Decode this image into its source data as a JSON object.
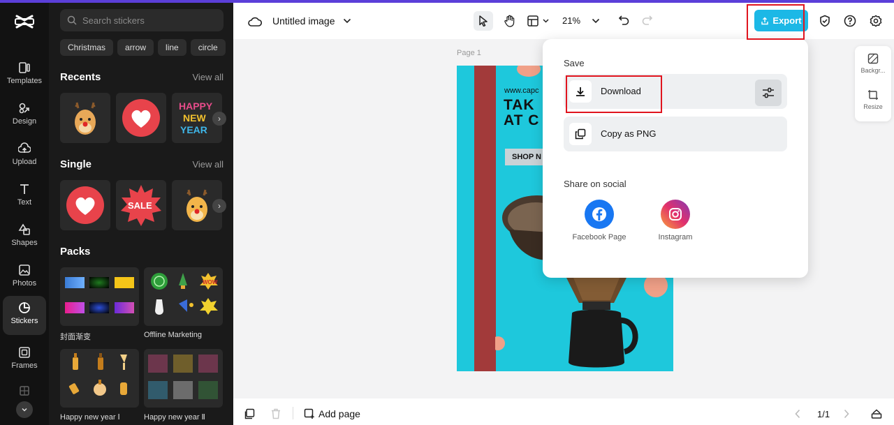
{
  "sidebar": {
    "items": [
      {
        "label": "Templates",
        "icon": "templates-icon"
      },
      {
        "label": "Design",
        "icon": "design-icon"
      },
      {
        "label": "Upload",
        "icon": "upload-icon"
      },
      {
        "label": "Text",
        "icon": "text-icon"
      },
      {
        "label": "Shapes",
        "icon": "shapes-icon"
      },
      {
        "label": "Photos",
        "icon": "photos-icon"
      },
      {
        "label": "Stickers",
        "icon": "stickers-icon",
        "active": true
      },
      {
        "label": "Frames",
        "icon": "frames-icon"
      }
    ]
  },
  "panel": {
    "search_placeholder": "Search stickers",
    "chips": [
      "Christmas",
      "arrow",
      "line",
      "circle"
    ],
    "recents_title": "Recents",
    "single_title": "Single",
    "packs_title": "Packs",
    "view_all": "View all",
    "sticker_texts": {
      "happy": "HAPPY",
      "new": "NEW",
      "year": "YEAR",
      "sale": "SALE",
      "wow": "WOW"
    },
    "pack_labels": [
      "封面渐变",
      "Offline Marketing",
      "Happy new year Ⅰ",
      "Happy new year Ⅱ"
    ]
  },
  "topbar": {
    "title": "Untitled image",
    "zoom": "21%",
    "export_label": "Export"
  },
  "canvas": {
    "page_label": "Page 1",
    "art_url": "www.capc",
    "art_headline_1": "TAK",
    "art_headline_2": "AT C",
    "art_button": "SHOP N"
  },
  "export_menu": {
    "save_label": "Save",
    "download_label": "Download",
    "copy_label": "Copy as PNG",
    "share_label": "Share on social",
    "facebook_label": "Facebook Page",
    "instagram_label": "Instagram"
  },
  "right_panel": {
    "background_label": "Backgr...",
    "resize_label": "Resize"
  },
  "bottombar": {
    "add_page": "Add page",
    "page_count": "1/1"
  },
  "colors": {
    "accent": "#1cb8e6",
    "highlight": "#e0141e",
    "artboard": "#1ec8dc"
  }
}
